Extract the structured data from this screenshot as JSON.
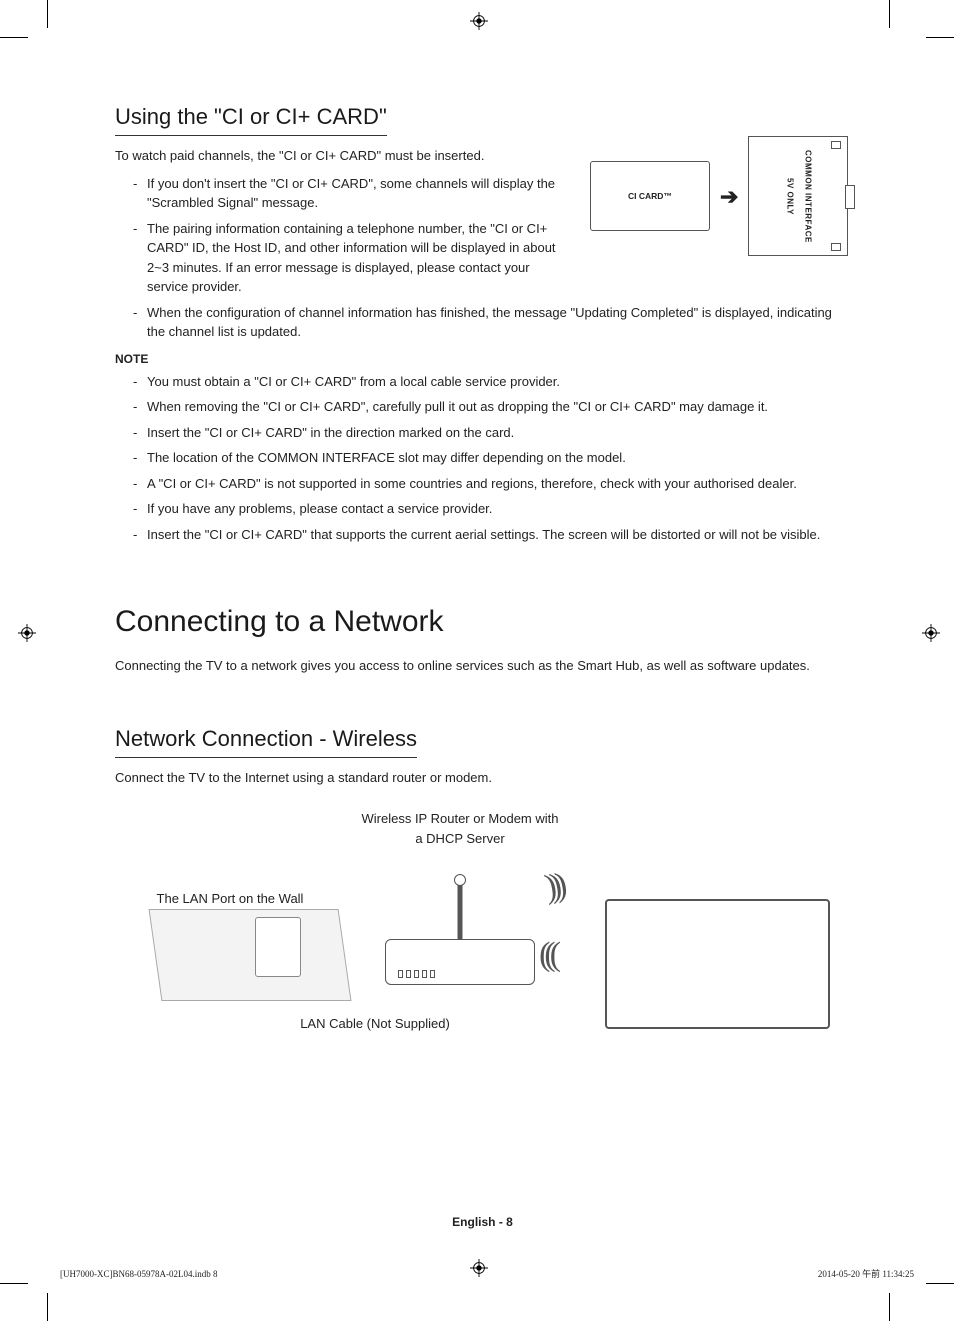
{
  "section1": {
    "heading": "Using the \"CI or CI+ CARD\"",
    "intro": "To watch paid channels, the \"CI or CI+ CARD\" must be inserted.",
    "bullets": [
      "If you don't insert the \"CI or CI+ CARD\", some channels will display the \"Scrambled Signal\" message.",
      "The pairing information containing a telephone number, the \"CI or CI+ CARD\" ID, the Host ID, and other information will be displayed in about 2~3 minutes. If an error message is displayed, please contact your service provider.",
      "When the configuration of channel information has finished, the message \"Updating Completed\" is displayed, indicating the channel list is updated."
    ],
    "note_heading": "NOTE",
    "notes": [
      "You must obtain a \"CI or CI+ CARD\" from a local cable service provider.",
      "When removing the \"CI or CI+ CARD\", carefully pull it out as dropping the \"CI or CI+ CARD\" may damage it.",
      "Insert the \"CI or CI+ CARD\" in the direction marked on the card.",
      "The location of the COMMON INTERFACE slot may differ depending on the model.",
      "A \"CI or CI+ CARD\" is not supported in some countries and regions, therefore, check with your authorised dealer.",
      "If you have any problems, please contact a service provider.",
      "Insert the \"CI or CI+ CARD\" that supports the current aerial settings. The screen will be distorted or will not be visible."
    ],
    "figure": {
      "card_label": "CI CARD™",
      "slot_label_1": "5V ONLY",
      "slot_label_2": "COMMON INTERFACE"
    }
  },
  "section2": {
    "heading": "Connecting to a Network",
    "intro": "Connecting the TV to a network gives you access to online services such as the Smart Hub, as well as software updates."
  },
  "section3": {
    "heading": "Network Connection - Wireless",
    "intro": "Connect the TV to the Internet using a standard router or modem.",
    "figure": {
      "router_label_1": "Wireless IP Router or Modem with",
      "router_label_2": "a DHCP Server",
      "wall_label": "The LAN Port on the Wall",
      "cable_label": "LAN Cable (Not Supplied)"
    }
  },
  "footer": {
    "page_lang": "English - 8",
    "print_left": "[UH7000-XC]BN68-05978A-02L04.indb   8",
    "print_right": "2014-05-20   午前 11:34:25"
  }
}
